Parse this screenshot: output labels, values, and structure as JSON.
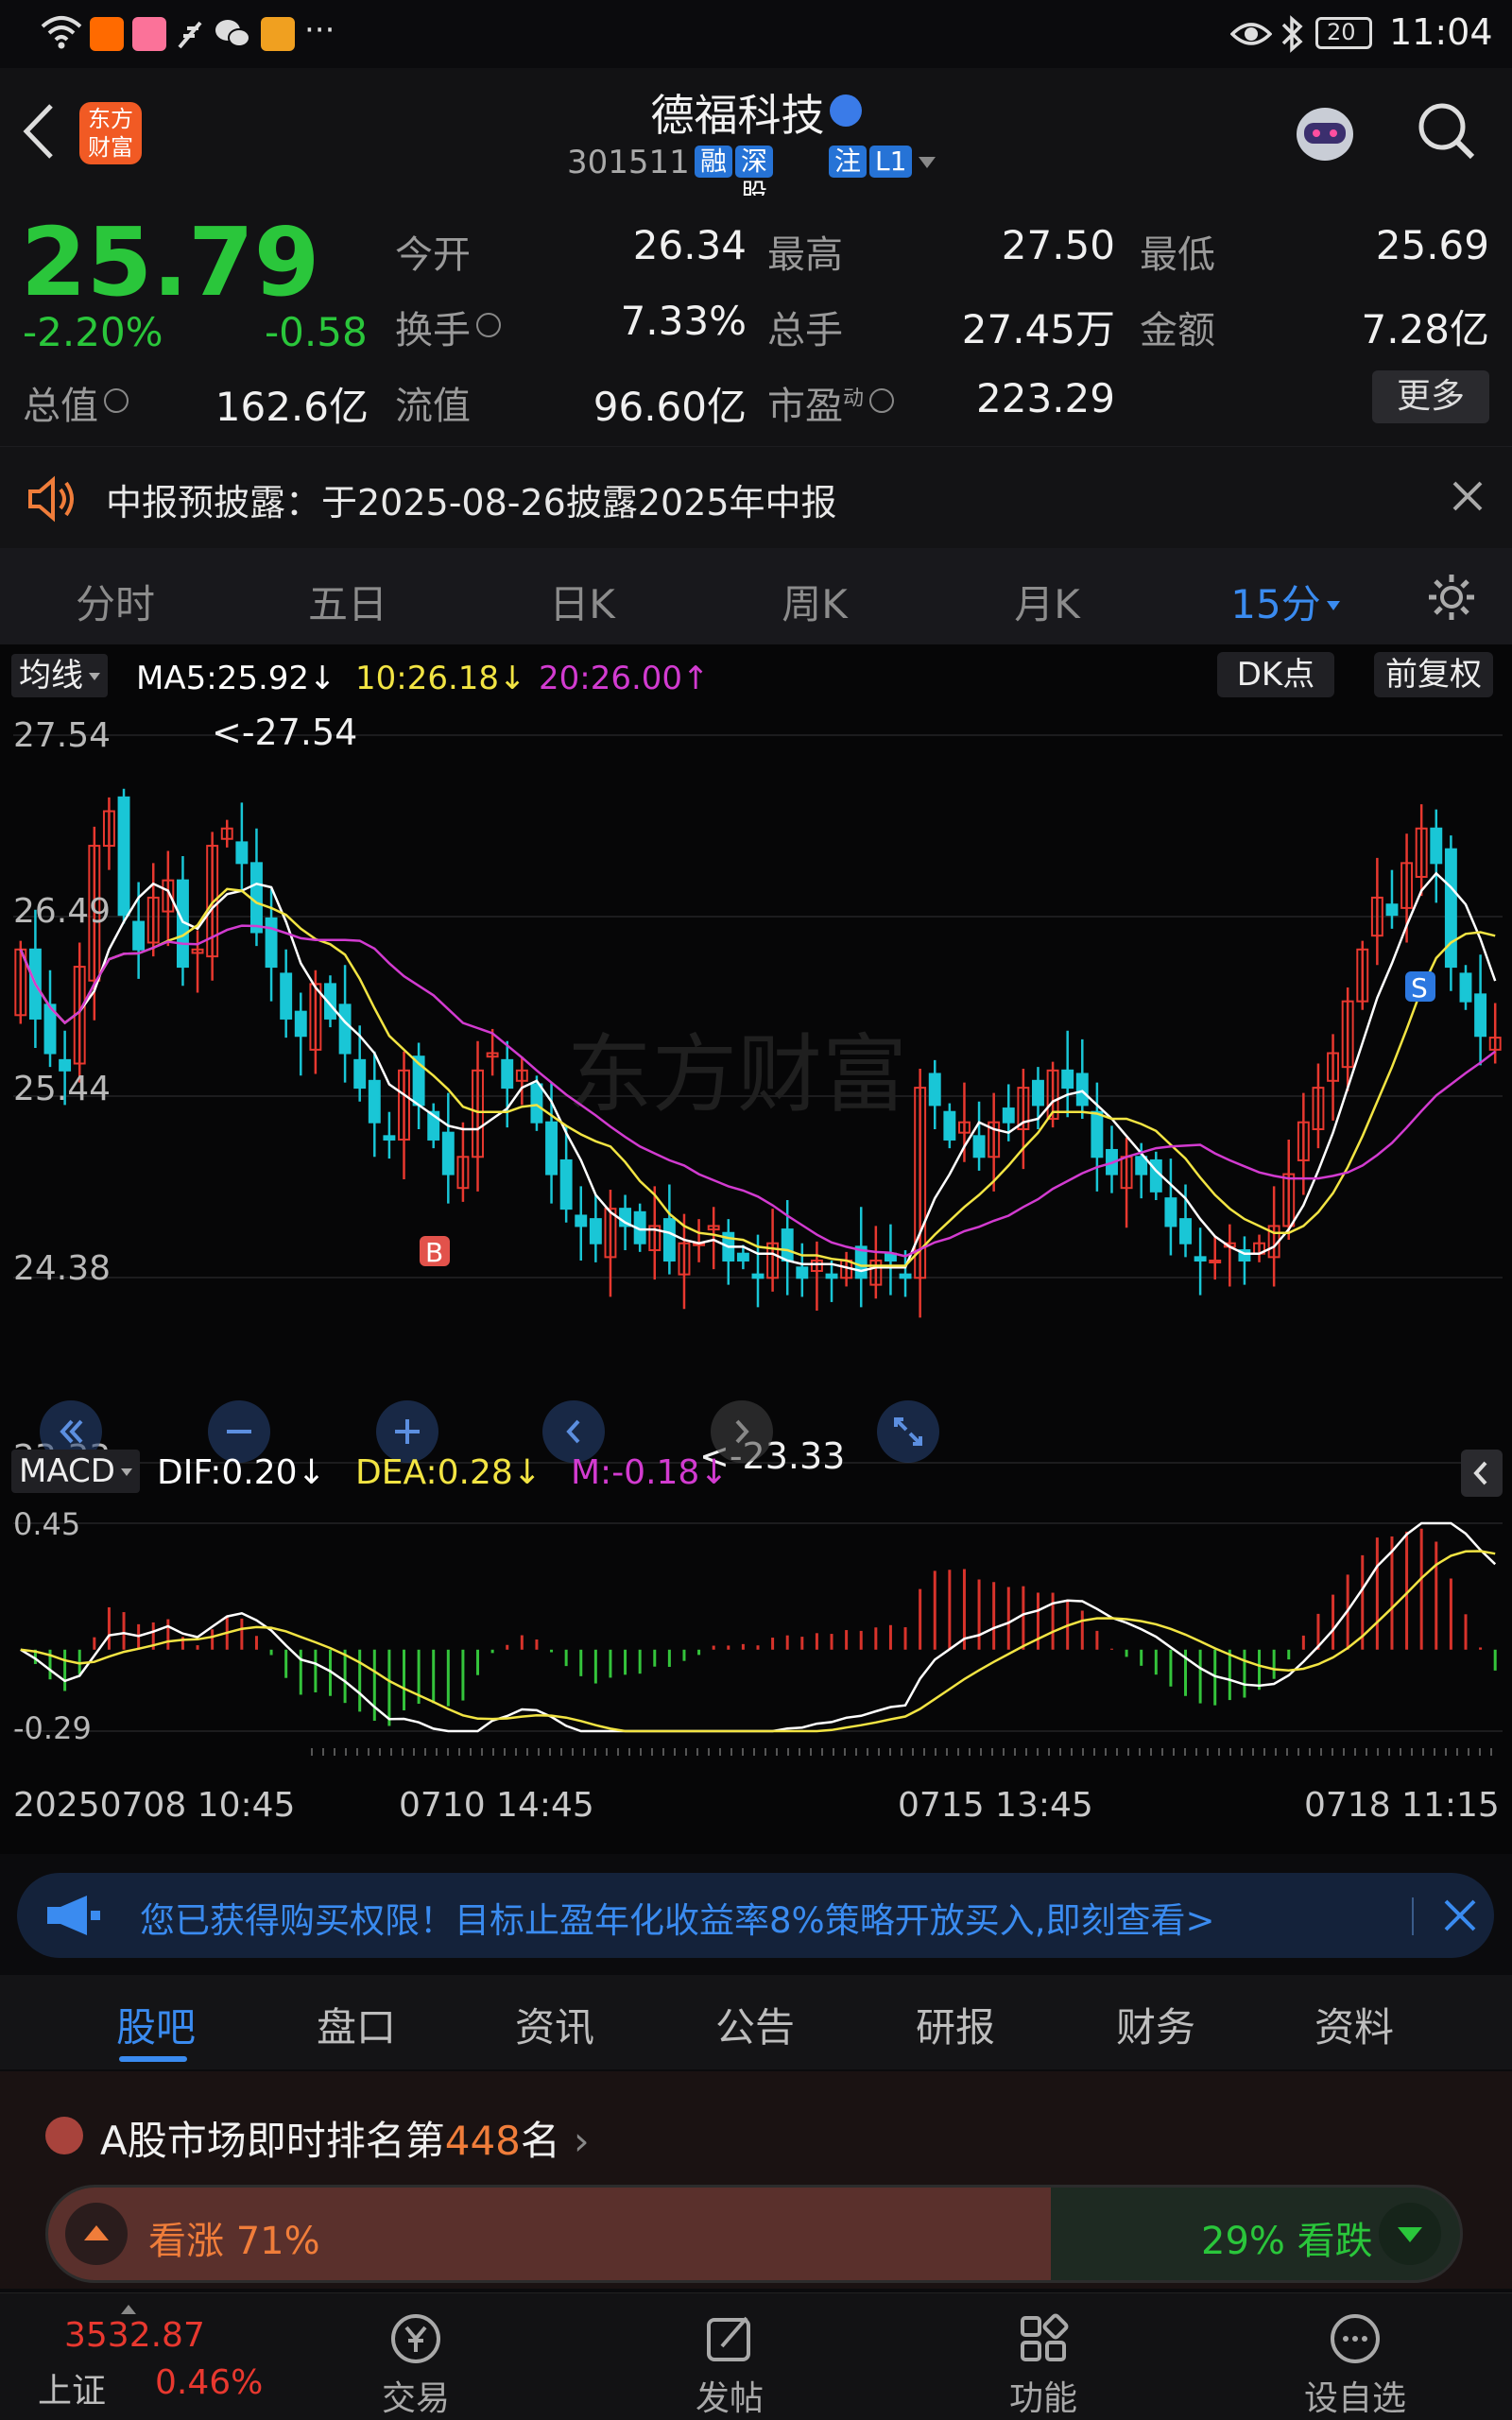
{
  "status_bar": {
    "time": "11:04",
    "battery": "20",
    "more": "···"
  },
  "header": {
    "name": "德福科技",
    "code": "301511",
    "badges": [
      "融",
      "深股通",
      "注",
      "L1"
    ],
    "logo_text": "东方财富"
  },
  "quote": {
    "price": "25.79",
    "change_pct": "-2.20%",
    "change": "-0.58",
    "total_value_label": "总值",
    "total_value": "162.6亿",
    "open_label": "今开",
    "open": "26.34",
    "turnover_label": "换手",
    "turnover": "7.33%",
    "float_value_label": "流值",
    "float_value": "96.60亿",
    "high_label": "最高",
    "high": "27.50",
    "volume_label": "总手",
    "volume": "27.45万",
    "pe_label": "市盈",
    "pe_sup": "动",
    "pe": "223.29",
    "low_label": "最低",
    "low": "25.69",
    "amount_label": "金额",
    "amount": "7.28亿",
    "more_button": "更多"
  },
  "notice": {
    "text": "中报预披露：于2025-08-26披露2025年中报"
  },
  "chart_tabs": [
    "分时",
    "五日",
    "日K",
    "周K",
    "月K",
    "15分",
    ""
  ],
  "chart_tabs_active": "15分",
  "ma": {
    "select": "均线",
    "ma5": "MA5:25.92↓",
    "ma10": "10:26.18↓",
    "ma20": "20:26.00↑",
    "dk_button": "DK点",
    "adjust_button": "前复权"
  },
  "kline": {
    "y_ticks": [
      "27.54",
      "26.49",
      "25.44",
      "24.38",
      "23.33"
    ],
    "max_marker": "<-27.54",
    "min_marker": "<-23.33",
    "buy_marker": "B",
    "sell_marker": "S",
    "watermark": "东方财富"
  },
  "macd": {
    "select": "MACD",
    "dif": "DIF:0.20↓",
    "dea": "DEA:0.28↓",
    "m": "M:-0.18↓",
    "y_top": "0.45",
    "y_bottom": "-0.29"
  },
  "x_axis": [
    "20250708 10:45",
    "0710 14:45",
    "0715 13:45",
    "0718 11:15"
  ],
  "ad": {
    "text": "您已获得购买权限！目标止盈年化收益率8%策略开放买入,即刻查看>"
  },
  "sub_tabs": [
    "股吧",
    "盘口",
    "资讯",
    "公告",
    "研报",
    "财务",
    "资料"
  ],
  "sub_tabs_active": "股吧",
  "rank": {
    "text_prefix": "A股市场即时排名第",
    "rank_value": "448",
    "text_suffix": "名",
    "bull": "看涨 71%",
    "bear": "29% 看跌",
    "bull_fraction": 0.71
  },
  "bottom_nav": {
    "index_value": "3532.87",
    "index_name": "上证",
    "index_change": "0.46%",
    "items": [
      "交易",
      "发帖",
      "功能",
      "设自选"
    ]
  },
  "colors": {
    "up": "#e8382f",
    "down": "#2ac63b",
    "ma5": "#ffffff",
    "ma10": "#f2e443",
    "ma20": "#d23bd0",
    "accent": "#3a8bf0"
  },
  "chart_data": {
    "type": "candlestick",
    "y_range": [
      23.33,
      27.54
    ],
    "closes": [
      26.3,
      25.9,
      25.7,
      25.6,
      26.2,
      26.9,
      27.1,
      26.5,
      26.3,
      26.6,
      26.7,
      26.2,
      26.3,
      26.9,
      27.0,
      26.8,
      26.4,
      26.2,
      25.9,
      25.8,
      26.1,
      25.9,
      25.7,
      25.5,
      25.3,
      25.2,
      25.6,
      25.4,
      25.2,
      25.0,
      25.1,
      25.6,
      25.7,
      25.5,
      25.6,
      25.3,
      25.0,
      24.8,
      24.7,
      24.6,
      24.8,
      24.7,
      24.6,
      24.7,
      24.5,
      24.6,
      24.6,
      24.7,
      24.5,
      24.5,
      24.4,
      24.6,
      24.5,
      24.4,
      24.5,
      24.4,
      24.5,
      24.4,
      24.5,
      24.5,
      24.4,
      25.5,
      25.4,
      25.2,
      25.3,
      25.1,
      25.3,
      25.3,
      25.5,
      25.4,
      25.6,
      25.5,
      25.4,
      25.1,
      25.0,
      25.1,
      25.0,
      24.9,
      24.7,
      24.6,
      24.5,
      24.5,
      24.6,
      24.5,
      24.6,
      24.7,
      25.0,
      25.3,
      25.5,
      25.7,
      26.0,
      26.3,
      26.6,
      26.5,
      26.8,
      27.0,
      26.8,
      26.2,
      26.0,
      25.8,
      25.79
    ]
  }
}
